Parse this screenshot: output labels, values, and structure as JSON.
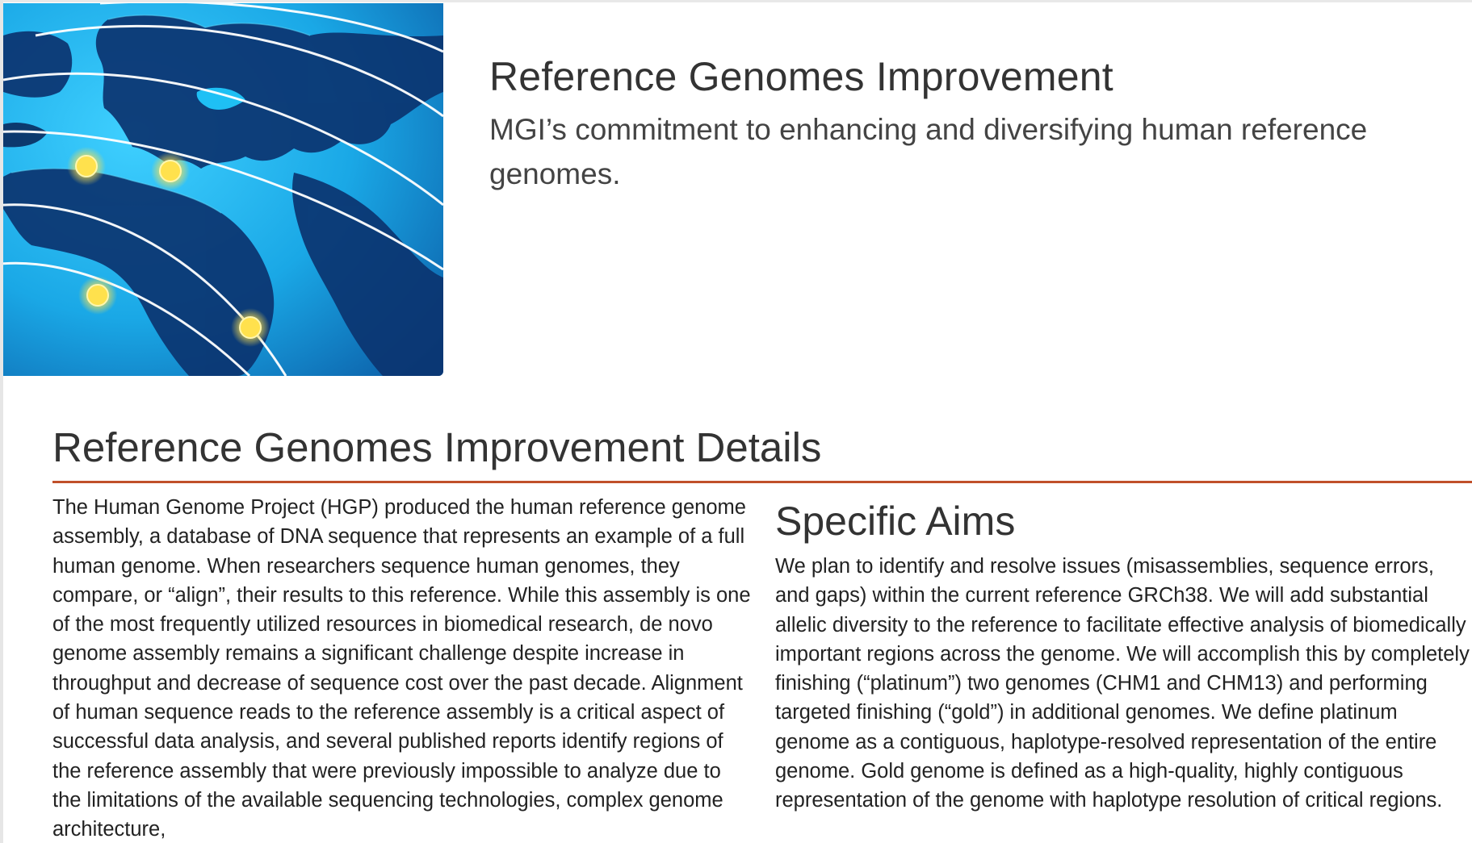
{
  "hero": {
    "image_alt": "World map with glowing connection arcs",
    "title": "Reference Genomes Improvement",
    "subtitle": "MGI’s commitment to enhancing and diversifying human reference genomes."
  },
  "details": {
    "heading": "Reference Genomes Improvement Details",
    "body": "The Human Genome Project (HGP) produced the human reference genome assembly, a database of DNA sequence that represents an example of a full human genome. When researchers sequence human genomes, they compare, or “align”, their results to this reference. While this assembly is one of the most frequently utilized resources in biomedical research, de novo genome assembly remains a significant challenge despite increase in throughput and decrease of sequence cost over the past decade. Alignment of human sequence reads to the reference assembly is a critical aspect of successful data analysis, and several published reports identify regions of the reference assembly that were previously impossible to analyze due to the limitations of the available sequencing technologies, complex genome architecture,"
  },
  "aims": {
    "heading": "Specific Aims",
    "body": "We plan to identify and resolve issues (misassemblies, sequence errors, and gaps) within the current reference GRCh38. We will add substantial allelic diversity to the reference to facilitate effective analysis of biomedically important regions across the genome. We will accomplish this by completely finishing (“platinum”) two genomes (CHM1 and CHM13) and performing targeted finishing (“gold”) in additional genomes. We define platinum genome as a contiguous, haplotype-resolved representation of the entire genome. Gold genome is defined as a high-quality, highly contiguous representation of the genome with haplotype resolution of critical regions."
  },
  "colors": {
    "accent_rule": "#c0502a",
    "ocean": "#1fb0e8",
    "land": "#0a2f63",
    "marker": "#ffe14d"
  }
}
